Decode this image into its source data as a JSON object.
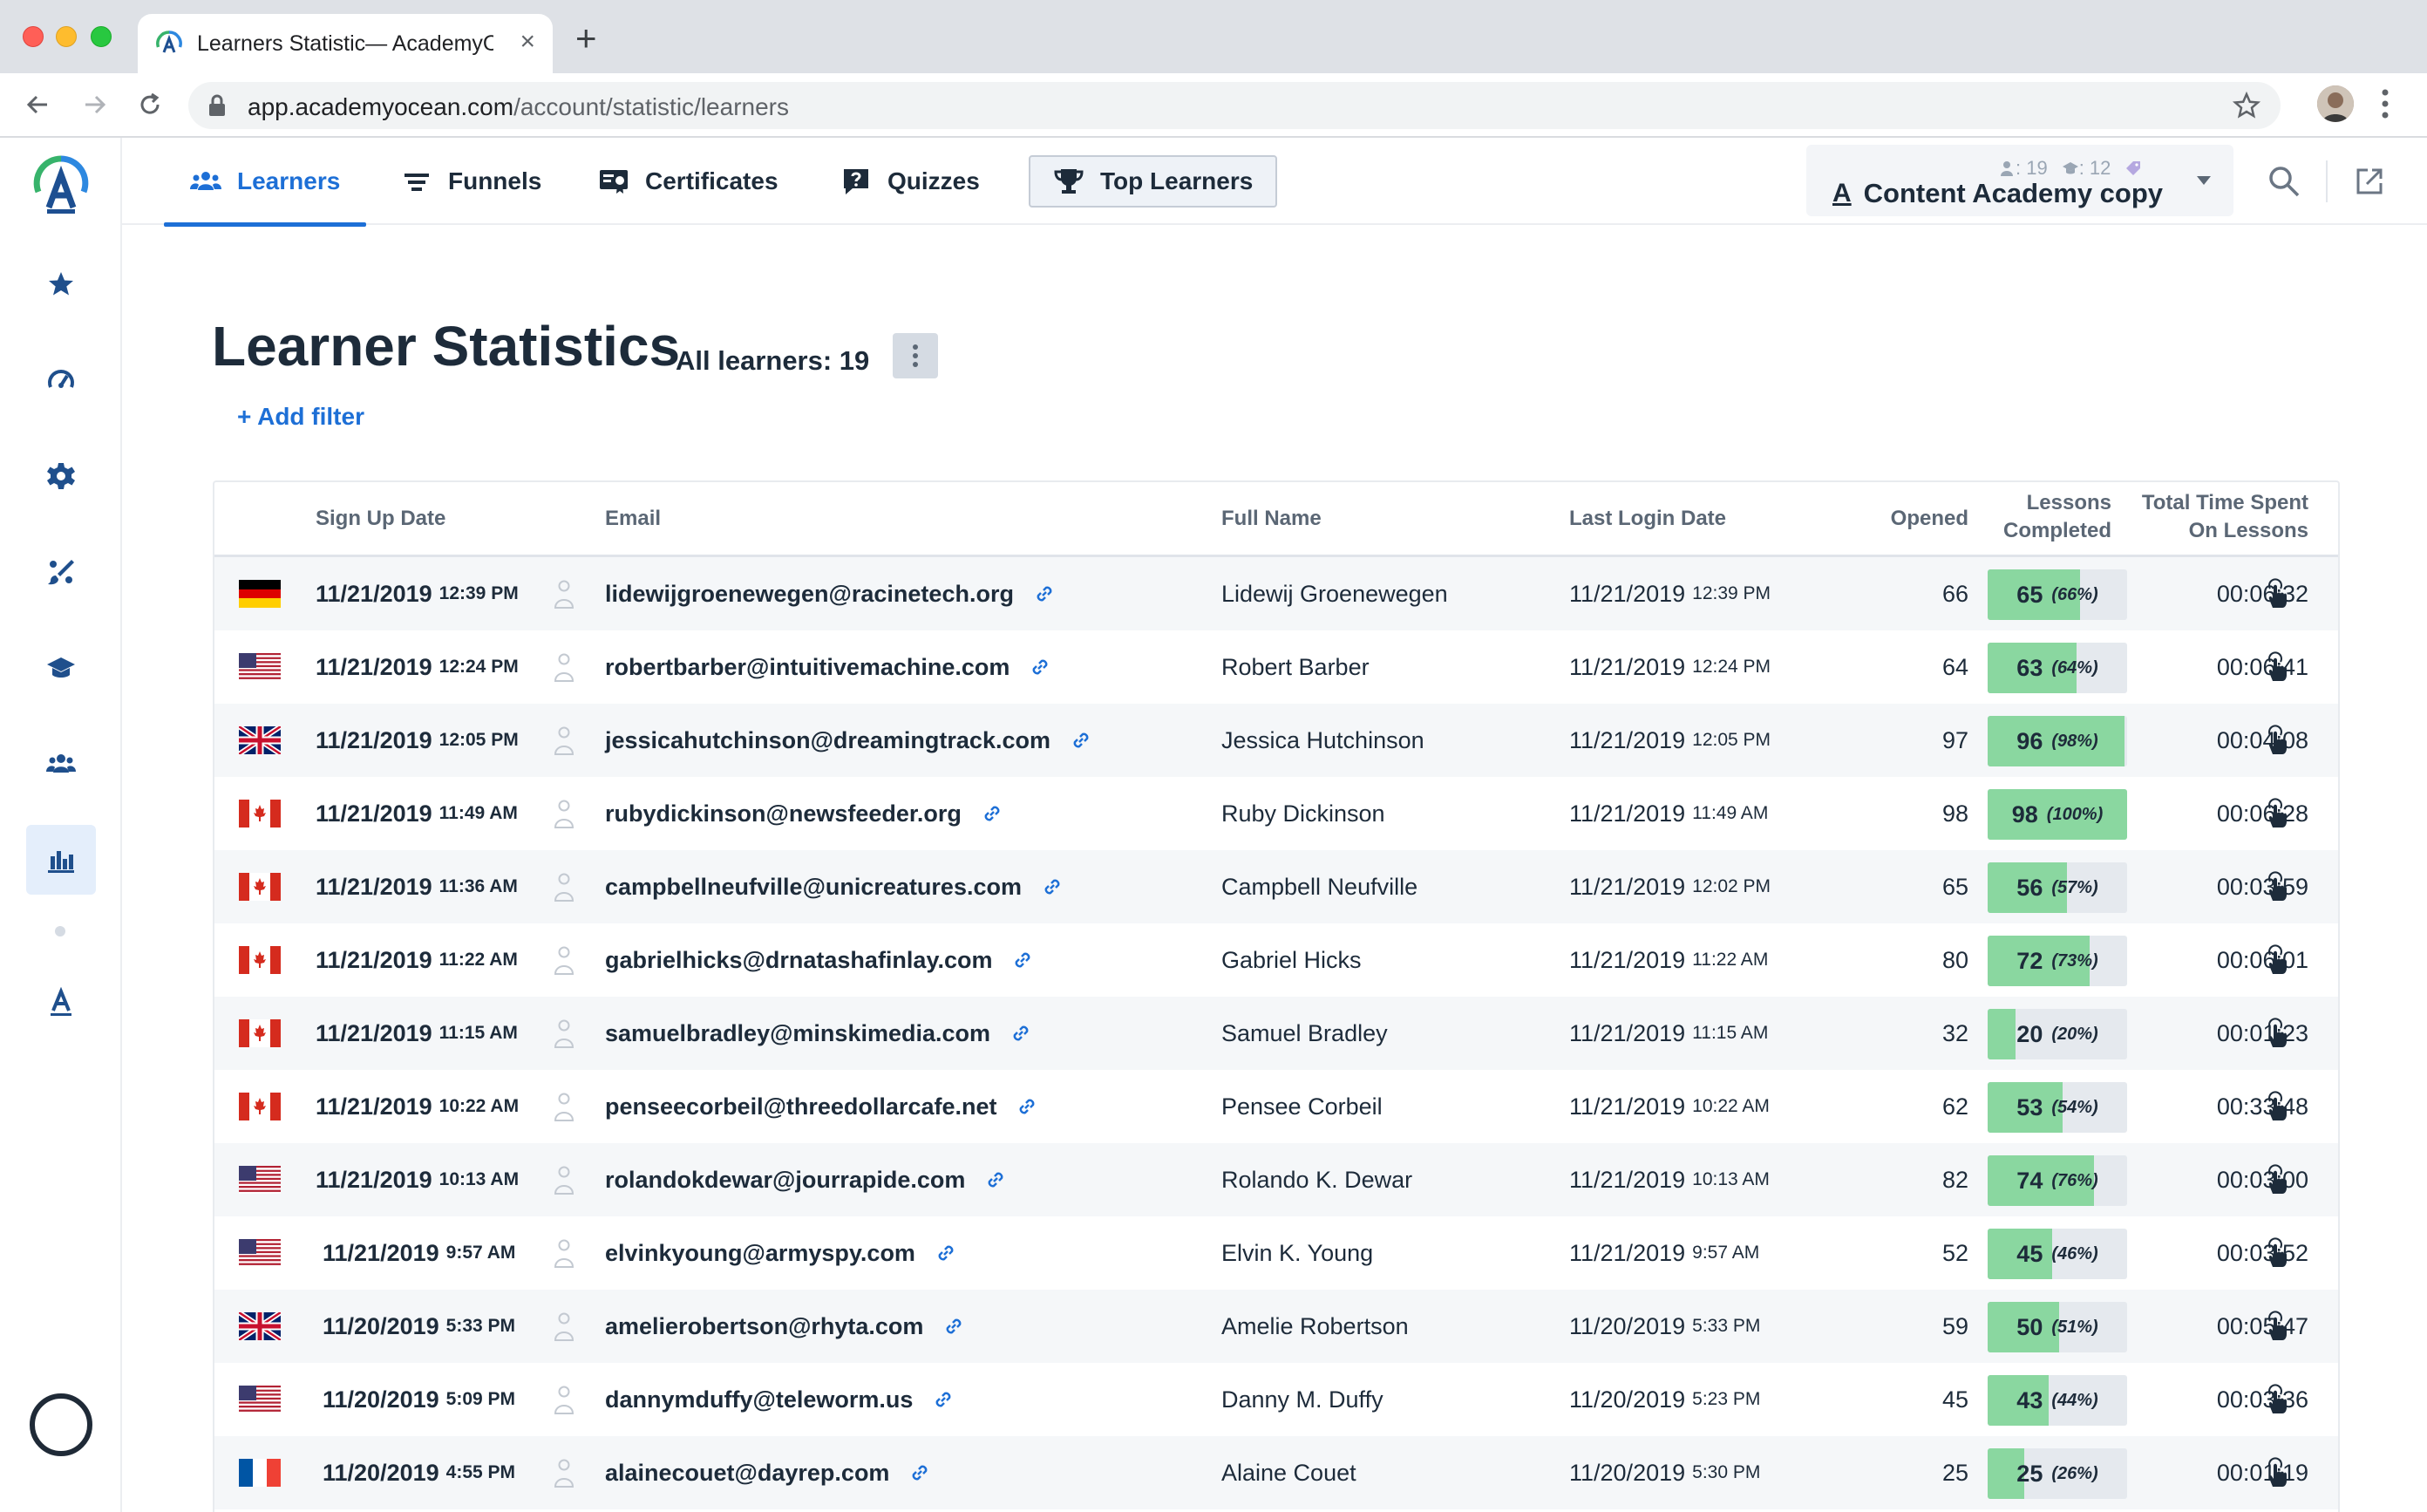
{
  "browser": {
    "tab_title": "Learners Statistic— AcademyOcean",
    "url_host": "app.academyocean.com",
    "url_path": "/account/statistic/learners"
  },
  "nav": {
    "tabs": [
      {
        "label": "Learners",
        "icon": "people-icon",
        "active": true
      },
      {
        "label": "Funnels",
        "icon": "funnel-icon",
        "active": false
      },
      {
        "label": "Certificates",
        "icon": "certificate-icon",
        "active": false
      },
      {
        "label": "Quizzes",
        "icon": "quiz-icon",
        "active": false
      },
      {
        "label": "Top Learners",
        "icon": "trophy-icon",
        "active": false
      }
    ]
  },
  "academy": {
    "name": "Content Academy copy",
    "learners_count": ": 19",
    "courses_count": ": 12"
  },
  "page": {
    "title": "Learner Statistics",
    "all_learners": "All learners: 19",
    "add_filter": "+ Add filter"
  },
  "table": {
    "headers": {
      "signup": "Sign Up Date",
      "email": "Email",
      "fullname": "Full Name",
      "lastlogin": "Last Login Date",
      "opened": "Opened",
      "lessons_line1": "Lessons",
      "lessons_line2": "Completed",
      "total_line1": "Total Time Spent",
      "total_line2": "On Lessons"
    },
    "rows": [
      {
        "flag": "de",
        "signup_date": "11/21/2019",
        "signup_time": "12:39 PM",
        "email": "lidewijgroenewegen@racinetech.org",
        "name": "Lidewij Groenewegen",
        "login_date": "11/21/2019",
        "login_time": "12:39 PM",
        "opened": "66",
        "lessons": "65",
        "pct_label": "(66%)",
        "pct": 66,
        "total": "00:06:32"
      },
      {
        "flag": "us",
        "signup_date": "11/21/2019",
        "signup_time": "12:24 PM",
        "email": "robertbarber@intuitivemachine.com",
        "name": "Robert Barber",
        "login_date": "11/21/2019",
        "login_time": "12:24 PM",
        "opened": "64",
        "lessons": "63",
        "pct_label": "(64%)",
        "pct": 64,
        "total": "00:06:41"
      },
      {
        "flag": "gb",
        "signup_date": "11/21/2019",
        "signup_time": "12:05 PM",
        "email": "jessicahutchinson@dreamingtrack.com",
        "name": "Jessica Hutchinson",
        "login_date": "11/21/2019",
        "login_time": "12:05 PM",
        "opened": "97",
        "lessons": "96",
        "pct_label": "(98%)",
        "pct": 98,
        "total": "00:04:08"
      },
      {
        "flag": "ca",
        "signup_date": "11/21/2019",
        "signup_time": "11:49 AM",
        "email": "rubydickinson@newsfeeder.org",
        "name": "Ruby Dickinson",
        "login_date": "11/21/2019",
        "login_time": "11:49 AM",
        "opened": "98",
        "lessons": "98",
        "pct_label": "(100%)",
        "pct": 100,
        "total": "00:06:28"
      },
      {
        "flag": "ca",
        "signup_date": "11/21/2019",
        "signup_time": "11:36 AM",
        "email": "campbellneufville@unicreatures.com",
        "name": "Campbell Neufville",
        "login_date": "11/21/2019",
        "login_time": "12:02 PM",
        "opened": "65",
        "lessons": "56",
        "pct_label": "(57%)",
        "pct": 57,
        "total": "00:03:59"
      },
      {
        "flag": "ca",
        "signup_date": "11/21/2019",
        "signup_time": "11:22 AM",
        "email": "gabrielhicks@drnatashafinlay.com",
        "name": "Gabriel Hicks",
        "login_date": "11/21/2019",
        "login_time": "11:22 AM",
        "opened": "80",
        "lessons": "72",
        "pct_label": "(73%)",
        "pct": 73,
        "total": "00:06:01"
      },
      {
        "flag": "ca",
        "signup_date": "11/21/2019",
        "signup_time": "11:15 AM",
        "email": "samuelbradley@minskimedia.com",
        "name": "Samuel Bradley",
        "login_date": "11/21/2019",
        "login_time": "11:15 AM",
        "opened": "32",
        "lessons": "20",
        "pct_label": "(20%)",
        "pct": 20,
        "total": "00:01:23"
      },
      {
        "flag": "ca",
        "signup_date": "11/21/2019",
        "signup_time": "10:22 AM",
        "email": "penseecorbeil@threedollarcafe.net",
        "name": "Pensee Corbeil",
        "login_date": "11/21/2019",
        "login_time": "10:22 AM",
        "opened": "62",
        "lessons": "53",
        "pct_label": "(54%)",
        "pct": 54,
        "total": "00:33:48"
      },
      {
        "flag": "us",
        "signup_date": "11/21/2019",
        "signup_time": "10:13 AM",
        "email": "rolandokdewar@jourrapide.com",
        "name": "Rolando K. Dewar",
        "login_date": "11/21/2019",
        "login_time": "10:13 AM",
        "opened": "82",
        "lessons": "74",
        "pct_label": "(76%)",
        "pct": 76,
        "total": "00:03:00"
      },
      {
        "flag": "us",
        "signup_date": "11/21/2019",
        "signup_time": "9:57 AM",
        "email": "elvinkyoung@armyspy.com",
        "name": "Elvin K. Young",
        "login_date": "11/21/2019",
        "login_time": "9:57 AM",
        "opened": "52",
        "lessons": "45",
        "pct_label": "(46%)",
        "pct": 46,
        "total": "00:03:52"
      },
      {
        "flag": "gb",
        "signup_date": "11/20/2019",
        "signup_time": "5:33 PM",
        "email": "amelierobertson@rhyta.com",
        "name": "Amelie Robertson",
        "login_date": "11/20/2019",
        "login_time": "5:33 PM",
        "opened": "59",
        "lessons": "50",
        "pct_label": "(51%)",
        "pct": 51,
        "total": "00:05:47"
      },
      {
        "flag": "us",
        "signup_date": "11/20/2019",
        "signup_time": "5:09 PM",
        "email": "dannymduffy@teleworm.us",
        "name": "Danny M. Duffy",
        "login_date": "11/20/2019",
        "login_time": "5:23 PM",
        "opened": "45",
        "lessons": "43",
        "pct_label": "(44%)",
        "pct": 44,
        "total": "00:03:36"
      },
      {
        "flag": "fr",
        "signup_date": "11/20/2019",
        "signup_time": "4:55 PM",
        "email": "alainecouet@dayrep.com",
        "name": "Alaine Couet",
        "login_date": "11/20/2019",
        "login_time": "5:30 PM",
        "opened": "25",
        "lessons": "25",
        "pct_label": "(26%)",
        "pct": 26,
        "total": "00:01:19"
      }
    ]
  },
  "colors": {
    "accent": "#1d6fd6",
    "progress_fill": "#8ad7a0",
    "progress_track": "#e5e9ee",
    "text": "#1d2b3a"
  }
}
